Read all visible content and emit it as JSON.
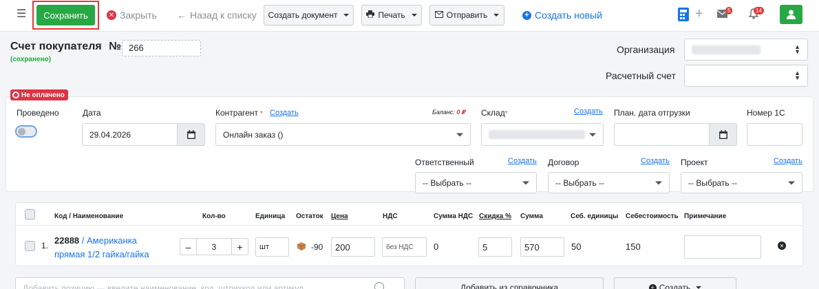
{
  "toolbar": {
    "save": "Сохранить",
    "close": "Закрыть",
    "back": "Назад к списку",
    "create_doc": "Создать документ",
    "print": "Печать",
    "send": "Отправить",
    "create_new": "Создать новый",
    "mail_count": "5",
    "notif_count": "14"
  },
  "header": {
    "title": "Счет покупателя",
    "number_sign": "№",
    "number": "266",
    "saved": "(сохранено)",
    "org_label": "Организация",
    "account_label": "Расчетный счет"
  },
  "form": {
    "status": "Не оплачено",
    "posted_label": "Проведено",
    "date_label": "Дата",
    "date_value": "29.04.2026",
    "counterparty_label": "Контрагент",
    "counterparty_create": "Создать",
    "counterparty_value": "Онлайн заказ ()",
    "balance_label": "Баланс:",
    "balance_value": "0 ₽",
    "warehouse_label": "Склад",
    "warehouse_create": "Создать",
    "ship_date_label": "План. дата отгрузки",
    "number_1c_label": "Номер 1С",
    "responsible_label": "Ответственный",
    "responsible_create": "Создать",
    "responsible_value": "-- Выбрать --",
    "contract_label": "Договор",
    "contract_create": "Создать",
    "contract_value": "-- Выбрать --",
    "project_label": "Проект",
    "project_create": "Создать",
    "project_value": "-- Выбрать --"
  },
  "table": {
    "headers": {
      "code_name": "Код / Наименование",
      "qty": "Кол-во",
      "unit": "Единица",
      "stock": "Остаток",
      "price": "Цена",
      "vat": "НДС",
      "vat_sum": "Сумма НДС",
      "discount": "Скидка %",
      "sum": "Сумма",
      "unit_cost": "Себ. единицы",
      "cost": "Себестоимость",
      "note": "Примечание"
    },
    "rows": [
      {
        "index": "1.",
        "code": "22888",
        "separator": " / ",
        "name_line1": "Американка",
        "name_line2": "прямая 1/2 гайка/гайка",
        "qty": "3",
        "unit": "шт",
        "stock": "-90",
        "price": "200",
        "vat": "без НДС",
        "vat_sum": "0",
        "discount": "5",
        "sum": "570",
        "unit_cost": "50",
        "cost": "150"
      }
    ]
  },
  "bottom": {
    "add_placeholder": "Добавить позицию — введите наименование, код, штрихкод или артикул",
    "add_from_catalog": "Добавить из справочника",
    "create": "Создать"
  },
  "colors": {
    "accent": "#1a73e8",
    "success": "#28a745",
    "danger": "#dc3545"
  }
}
